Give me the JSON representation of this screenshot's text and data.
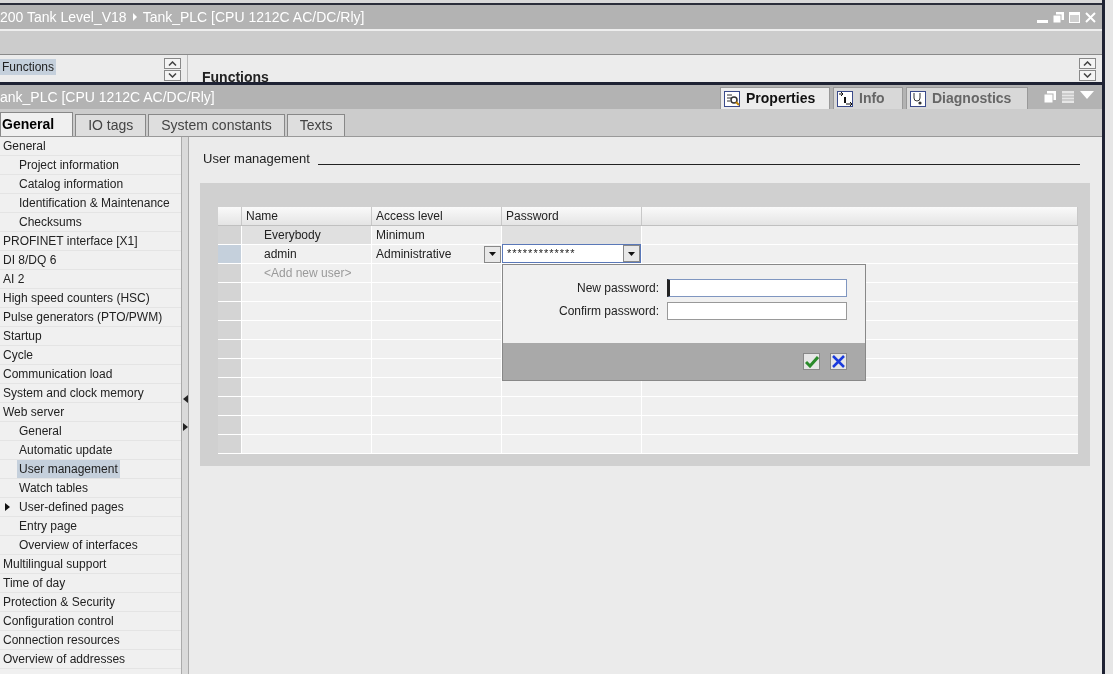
{
  "breadcrumb": [
    "200 Tank Level_V18",
    "Tank_PLC [CPU 1212C AC/DC/Rly]"
  ],
  "editor": {
    "list_item": {
      "label": "Functions",
      "selected": true
    },
    "heading": "Functions"
  },
  "inspector": {
    "title": "ank_PLC [CPU 1212C AC/DC/Rly]",
    "view_tabs": [
      {
        "label": "Properties",
        "kind": "properties",
        "selected": true
      },
      {
        "label": "Info",
        "kind": "info",
        "selected": false
      },
      {
        "label": "Diagnostics",
        "kind": "diagnostics",
        "selected": false
      }
    ],
    "tabs": [
      {
        "label": "General",
        "selected": true
      },
      {
        "label": "IO tags",
        "selected": false
      },
      {
        "label": "System constants",
        "selected": false
      },
      {
        "label": "Texts",
        "selected": false
      }
    ],
    "tree": [
      {
        "label": "General",
        "selected": false,
        "children": [
          {
            "label": "Project information",
            "selected": false
          },
          {
            "label": "Catalog information",
            "selected": false
          },
          {
            "label": "Identification & Maintenance",
            "selected": false
          },
          {
            "label": "Checksums",
            "selected": false
          }
        ]
      },
      {
        "label": "PROFINET interface [X1]",
        "selected": false
      },
      {
        "label": "DI 8/DQ 6",
        "selected": false
      },
      {
        "label": "AI 2",
        "selected": false
      },
      {
        "label": "High speed counters (HSC)",
        "selected": false
      },
      {
        "label": "Pulse generators (PTO/PWM)",
        "selected": false
      },
      {
        "label": "Startup",
        "selected": false
      },
      {
        "label": "Cycle",
        "selected": false
      },
      {
        "label": "Communication load",
        "selected": false
      },
      {
        "label": "System and clock memory",
        "selected": false
      },
      {
        "label": "Web server",
        "selected": false,
        "children": [
          {
            "label": "General",
            "selected": false
          },
          {
            "label": "Automatic update",
            "selected": false
          },
          {
            "label": "User management",
            "selected": true
          },
          {
            "label": "Watch tables",
            "selected": false
          },
          {
            "label": "User-defined pages",
            "selected": false,
            "expanded": false
          },
          {
            "label": "Entry page",
            "selected": false
          },
          {
            "label": "Overview of interfaces",
            "selected": false
          }
        ]
      },
      {
        "label": "Multilingual support",
        "selected": false
      },
      {
        "label": "Time of day",
        "selected": false
      },
      {
        "label": "Protection & Security",
        "selected": false
      },
      {
        "label": "Configuration control",
        "selected": false
      },
      {
        "label": "Connection resources",
        "selected": false
      },
      {
        "label": "Overview of addresses",
        "selected": false
      }
    ],
    "section_title": "User management",
    "table": {
      "columns": [
        "Name",
        "Access level",
        "Password"
      ],
      "rows": [
        {
          "name": "Everybody",
          "access_level": "Minimum",
          "read_only": true,
          "selected": false
        },
        {
          "name": "admin",
          "access_level": "Administrative",
          "password": "*************",
          "read_only": false,
          "selected": true
        }
      ],
      "new_row": "<Add new user>"
    },
    "password_popup": {
      "fields": [
        {
          "label": "New password:",
          "focused": true
        },
        {
          "label": "Confirm password:",
          "focused": false
        }
      ]
    }
  }
}
